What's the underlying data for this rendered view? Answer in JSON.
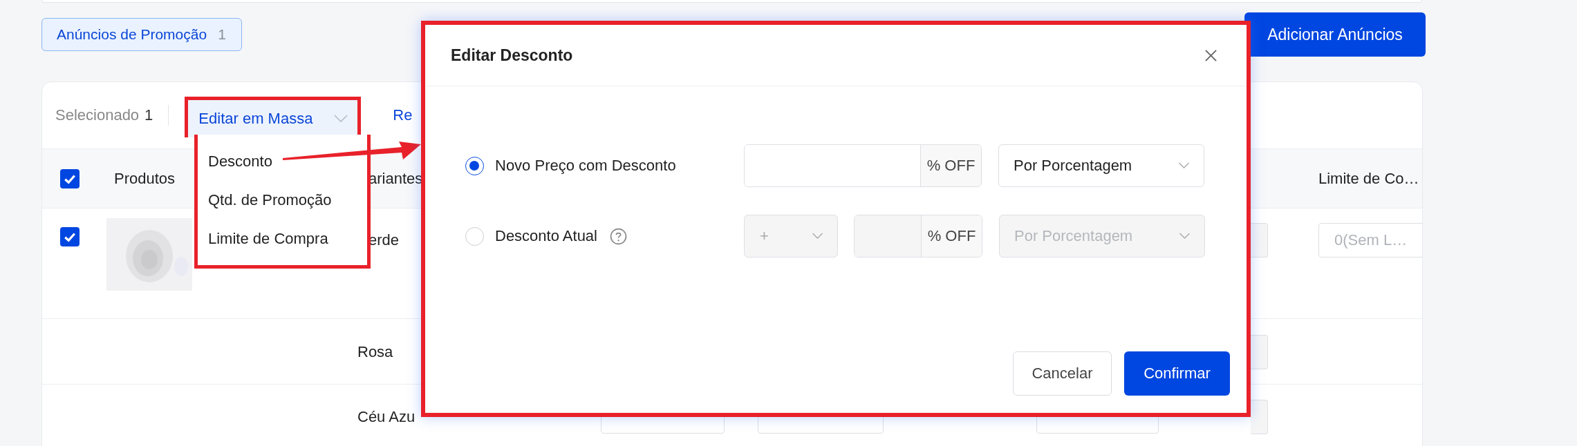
{
  "promo_tag": {
    "label": "Anúncios de Promoção",
    "count": "1"
  },
  "add_button": {
    "label": "Adicionar Anúncios"
  },
  "toolbar": {
    "selected_label": "Selecionado",
    "selected_count": "1",
    "bulk_edit": {
      "label": "Editar em Massa",
      "expanded": true
    },
    "link": "Re"
  },
  "bulk_menu": [
    {
      "label": "Desconto"
    },
    {
      "label": "Qtd. de Promoção"
    },
    {
      "label": "Limite de Compra"
    }
  ],
  "table": {
    "header": {
      "checked": true,
      "columns": [
        "Produtos",
        "ariantes",
        "Limite de Co…"
      ]
    },
    "rows": [
      {
        "checked": true,
        "variant": "erde",
        "limit_placeholder": "0(Sem L…"
      },
      {
        "variant": "Rosa"
      },
      {
        "variant": "Céu Azu",
        "hidden_fields": true
      }
    ]
  },
  "modal": {
    "title": "Editar Desconto",
    "options": [
      {
        "label": "Novo Preço com Desconto",
        "selected": true,
        "disabled": false,
        "help": false,
        "suffix": "% OFF",
        "mode": "Por Porcentagem"
      },
      {
        "label": "Desconto Atual",
        "selected": false,
        "disabled": true,
        "help": true,
        "sign": "+",
        "suffix": "% OFF",
        "mode": "Por Porcentagem"
      }
    ],
    "cancel": "Cancelar",
    "confirm": "Confirmar"
  }
}
